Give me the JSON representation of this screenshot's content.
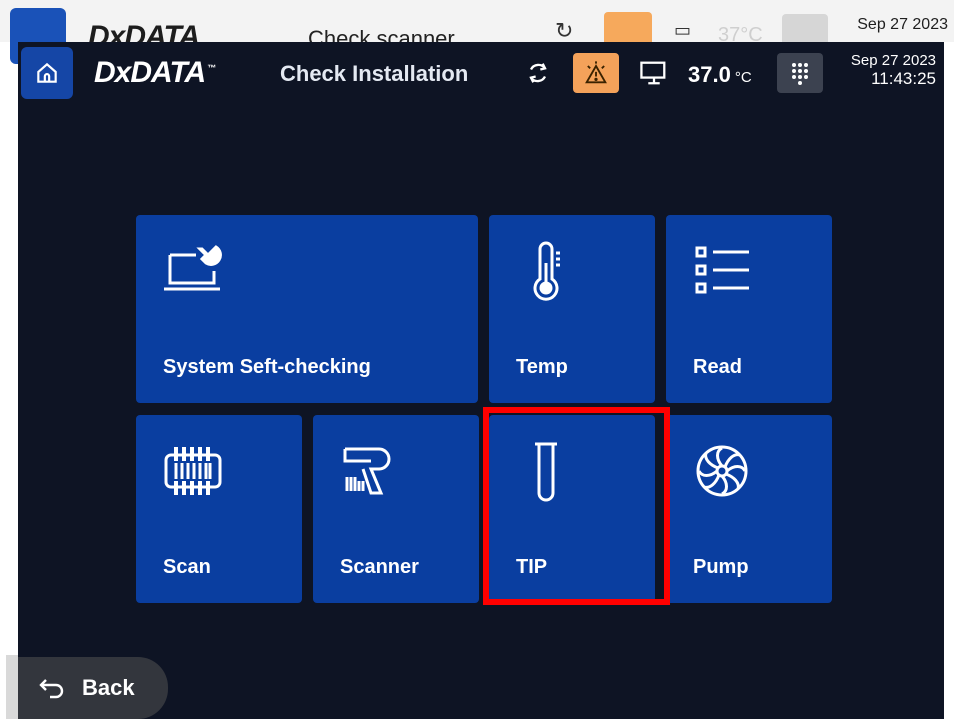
{
  "background_screen": {
    "logo": "DxDATA",
    "title": "Check scanner",
    "temperature": "37",
    "temperature_unit": "°C",
    "date": "Sep 27 2023"
  },
  "header": {
    "logo": "DxDATA",
    "logo_tm": "™",
    "title": "Check Installation",
    "temperature": "37.0",
    "temperature_unit": "°C",
    "date": "Sep 27 2023",
    "time": "11:43:25"
  },
  "tiles": [
    {
      "label": "System Seft-checking",
      "icon": "laptop-wrench-icon"
    },
    {
      "label": "Temp",
      "icon": "thermometer-icon"
    },
    {
      "label": "Read",
      "icon": "list-icon"
    },
    {
      "label": "Scan",
      "icon": "barcode-rack-icon"
    },
    {
      "label": "Scanner",
      "icon": "barcode-scanner-icon"
    },
    {
      "label": "TIP",
      "icon": "test-tube-icon"
    },
    {
      "label": "Pump",
      "icon": "fan-icon"
    }
  ],
  "footer": {
    "back_label": "Back"
  },
  "colors": {
    "screen_bg": "#0e1424",
    "tile_bg": "#0a3ea0",
    "alert": "#f4a25a",
    "highlight": "#ff0000"
  }
}
